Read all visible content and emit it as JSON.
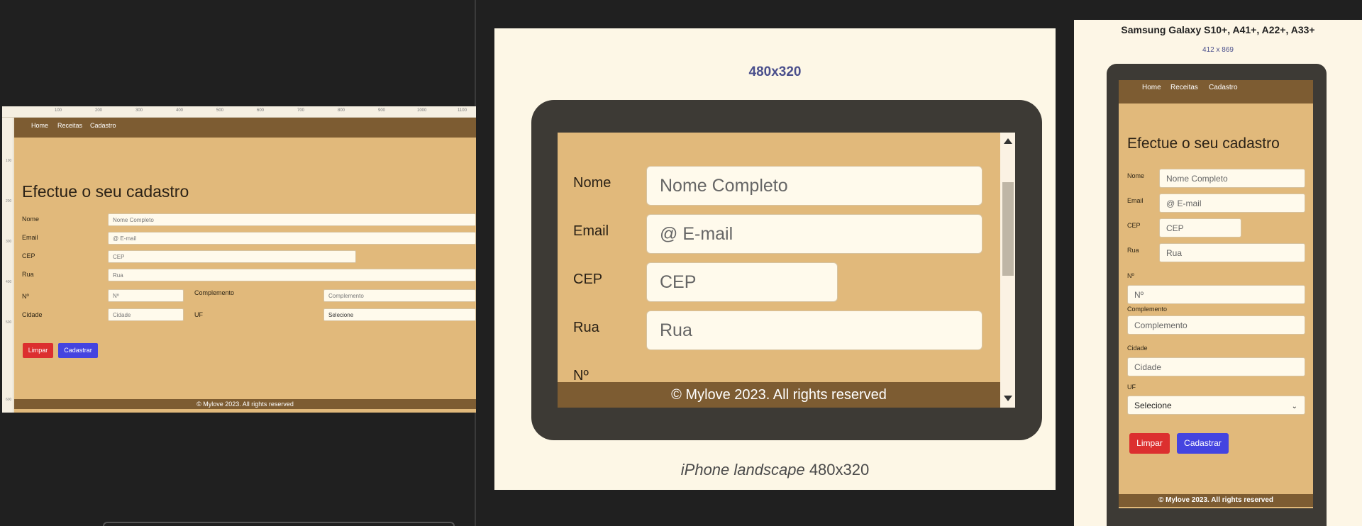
{
  "nav": {
    "home": "Home",
    "receitas": "Receitas",
    "cadastro": "Cadastro"
  },
  "form": {
    "heading": "Efectue o seu cadastro",
    "labels": {
      "nome": "Nome",
      "email": "Email",
      "cep": "CEP",
      "rua": "Rua",
      "numero": "Nº",
      "complemento": "Complemento",
      "cidade": "Cidade",
      "uf": "UF"
    },
    "placeholders": {
      "nome": "Nome Completo",
      "email": "@ E-mail",
      "cep": "CEP",
      "rua": "Rua",
      "numero": "Nº",
      "complemento": "Complemento",
      "cidade": "Cidade"
    },
    "uf_selected": "Selecione",
    "buttons": {
      "limpar": "Limpar",
      "cadastrar": "Cadastrar"
    },
    "colors": {
      "limpar": "#dc2f2f",
      "cadastrar": "#4444e0"
    }
  },
  "footer": "© Mylove 2023. All rights reserved",
  "ruler_ticks": [
    "100",
    "200",
    "300",
    "400",
    "500",
    "600",
    "700",
    "800",
    "900",
    "1000",
    "1100"
  ],
  "ruler_vticks": [
    "100",
    "200",
    "300",
    "400",
    "500",
    "600"
  ],
  "middle": {
    "size_label": "480x320",
    "caption_italic": "iPhone landscape",
    "caption_size": "480x320"
  },
  "right": {
    "device": "Samsung Galaxy S10+, A41+, A22+, A33+",
    "resolution": "412 x 869"
  },
  "colors": {
    "site_bg": "#e1b97b",
    "nav_bg": "#7d5c32",
    "page_bg": "#fdf6e6",
    "frame": "#3d3a35"
  }
}
